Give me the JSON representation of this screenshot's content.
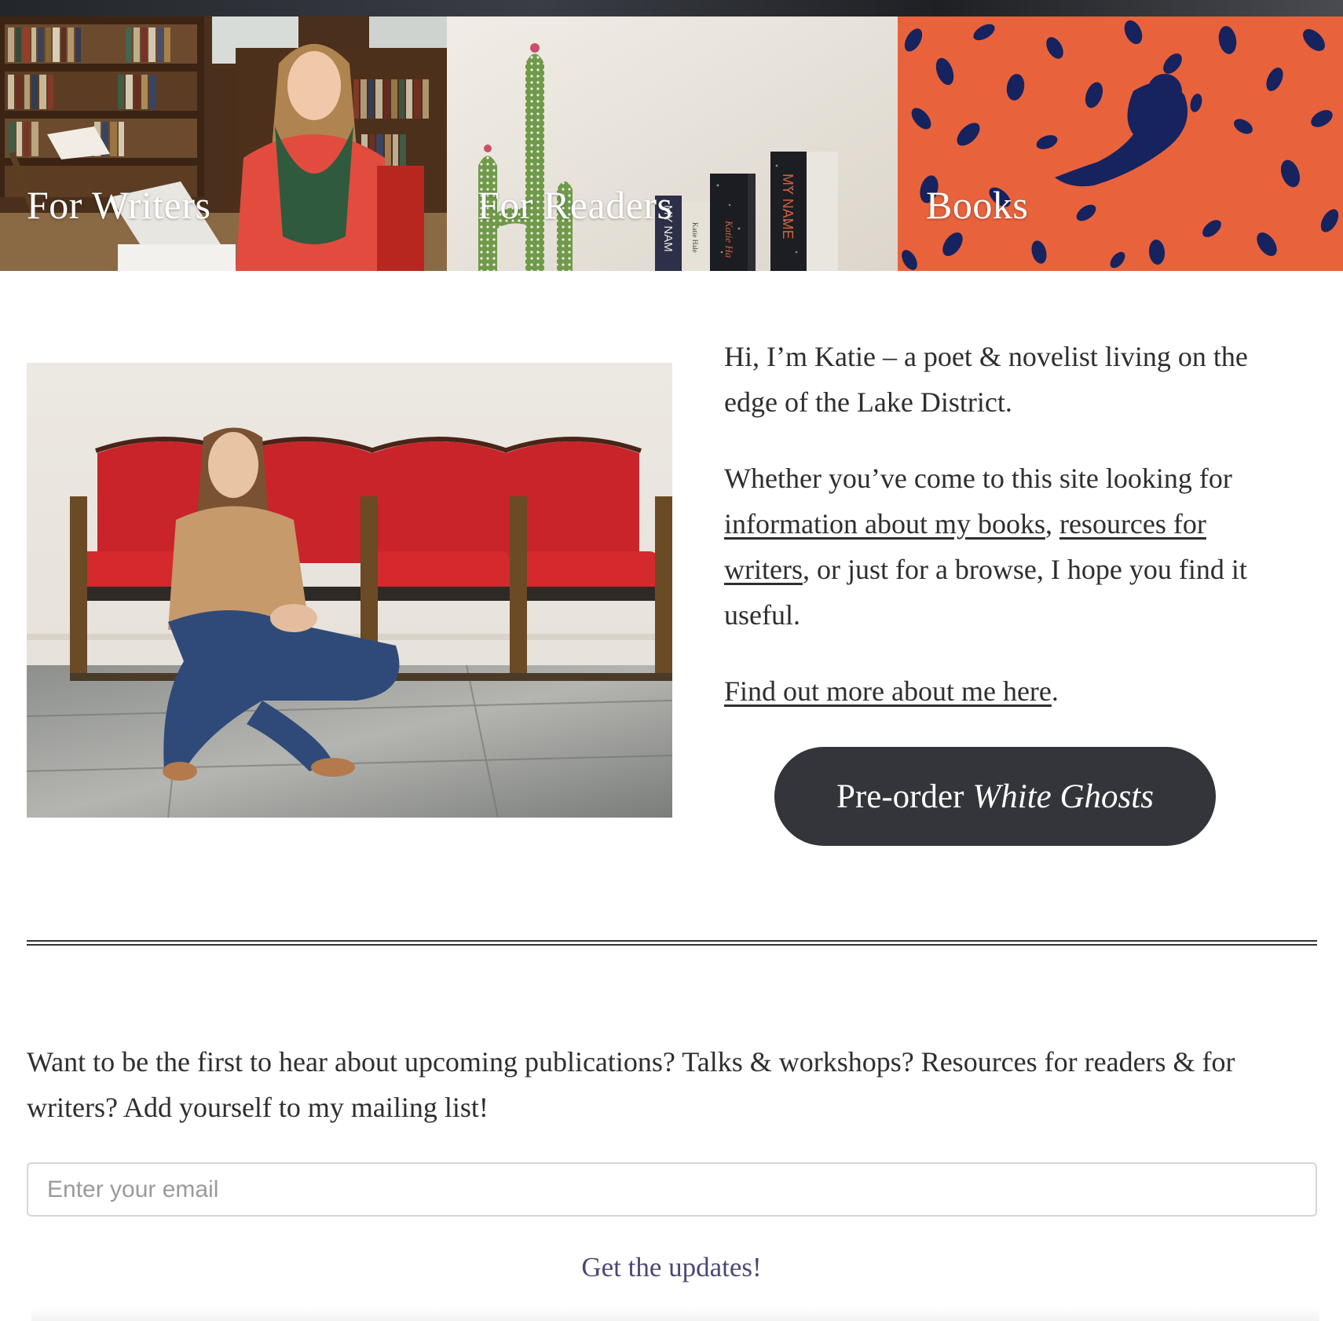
{
  "tiles": [
    {
      "label": "For Writers"
    },
    {
      "label": "For Readers"
    },
    {
      "label": "Books"
    }
  ],
  "intro": {
    "greeting": "Hi, I’m Katie – a poet & novelist living on the edge of the Lake District.",
    "para2_prefix": "Whether you’ve come to this site looking for ",
    "books_link": "information about my books",
    "para2_mid": ", ",
    "writers_link": "resources for writers",
    "para2_suffix": ", or just for a browse, I hope you find it useful.",
    "about_link": "Find out more about me here",
    "about_suffix": "."
  },
  "preorder": {
    "prefix": "Pre-order",
    "title": "White Ghosts"
  },
  "book_spines": {
    "spine1": "MY NAM",
    "spine2": "Katie Hale",
    "spine3": "Katie Ha",
    "spine4": "MY NAME"
  },
  "newsletter": {
    "text": "Want to be the first to hear about upcoming publications? Talks & workshops? Resources for readers & for writers? Add yourself to my mailing list!",
    "email_placeholder": "Enter your email",
    "submit_label": "Get the updates!"
  },
  "colors": {
    "button_bg": "#33353a",
    "link_accent": "#4a4876",
    "books_tile_bg": "#e8633c",
    "books_tile_pattern": "#16235f"
  }
}
